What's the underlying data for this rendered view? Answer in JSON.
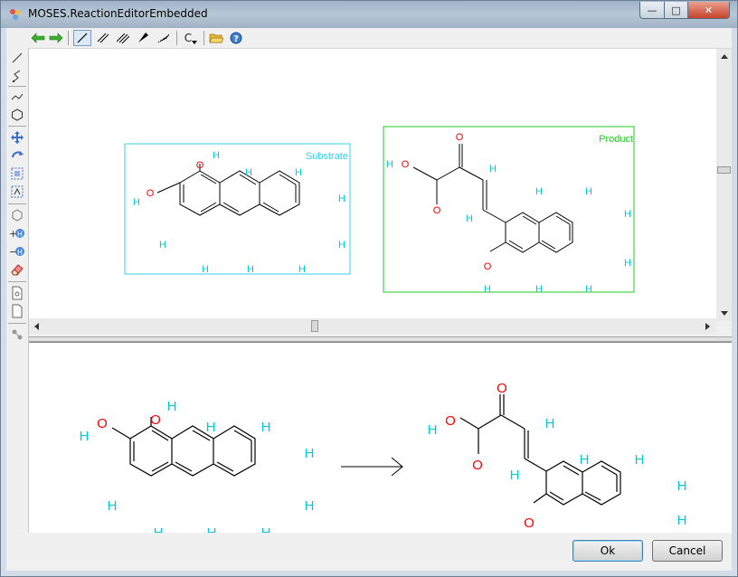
{
  "window": {
    "title": "MOSES.ReactionEditorEmbedded",
    "minimize_glyph": "—",
    "maximize_glyph": "□",
    "close_glyph": "✕"
  },
  "toolbar": {
    "element_selector": "C"
  },
  "editor": {
    "substrate_label": "Substrate",
    "product_label": "Product",
    "substrate_color": "#33d0e8",
    "product_color": "#22cc22"
  },
  "atoms": {
    "H": "H",
    "O": "O"
  },
  "buttons": {
    "ok": "Ok",
    "cancel": "Cancel"
  },
  "colors": {
    "oxygen": "#ff0000",
    "hydrogen": "#00c8d8",
    "bond": "#000000"
  }
}
